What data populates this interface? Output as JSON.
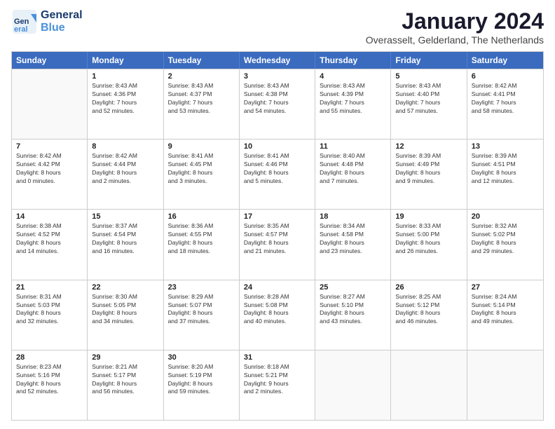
{
  "logo": {
    "general": "General",
    "blue": "Blue"
  },
  "header": {
    "title": "January 2024",
    "subtitle": "Overasselt, Gelderland, The Netherlands"
  },
  "weekdays": [
    "Sunday",
    "Monday",
    "Tuesday",
    "Wednesday",
    "Thursday",
    "Friday",
    "Saturday"
  ],
  "weeks": [
    [
      {
        "day": "",
        "empty": true
      },
      {
        "day": "1",
        "sunrise": "8:43 AM",
        "sunset": "4:36 PM",
        "daylight": "7 hours and 52 minutes."
      },
      {
        "day": "2",
        "sunrise": "8:43 AM",
        "sunset": "4:37 PM",
        "daylight": "7 hours and 53 minutes."
      },
      {
        "day": "3",
        "sunrise": "8:43 AM",
        "sunset": "4:38 PM",
        "daylight": "7 hours and 54 minutes."
      },
      {
        "day": "4",
        "sunrise": "8:43 AM",
        "sunset": "4:39 PM",
        "daylight": "7 hours and 55 minutes."
      },
      {
        "day": "5",
        "sunrise": "8:43 AM",
        "sunset": "4:40 PM",
        "daylight": "7 hours and 57 minutes."
      },
      {
        "day": "6",
        "sunrise": "8:42 AM",
        "sunset": "4:41 PM",
        "daylight": "7 hours and 58 minutes."
      }
    ],
    [
      {
        "day": "7",
        "sunrise": "8:42 AM",
        "sunset": "4:42 PM",
        "daylight": "8 hours and 0 minutes."
      },
      {
        "day": "8",
        "sunrise": "8:42 AM",
        "sunset": "4:44 PM",
        "daylight": "8 hours and 2 minutes."
      },
      {
        "day": "9",
        "sunrise": "8:41 AM",
        "sunset": "4:45 PM",
        "daylight": "8 hours and 3 minutes."
      },
      {
        "day": "10",
        "sunrise": "8:41 AM",
        "sunset": "4:46 PM",
        "daylight": "8 hours and 5 minutes."
      },
      {
        "day": "11",
        "sunrise": "8:40 AM",
        "sunset": "4:48 PM",
        "daylight": "8 hours and 7 minutes."
      },
      {
        "day": "12",
        "sunrise": "8:39 AM",
        "sunset": "4:49 PM",
        "daylight": "8 hours and 9 minutes."
      },
      {
        "day": "13",
        "sunrise": "8:39 AM",
        "sunset": "4:51 PM",
        "daylight": "8 hours and 12 minutes."
      }
    ],
    [
      {
        "day": "14",
        "sunrise": "8:38 AM",
        "sunset": "4:52 PM",
        "daylight": "8 hours and 14 minutes."
      },
      {
        "day": "15",
        "sunrise": "8:37 AM",
        "sunset": "4:54 PM",
        "daylight": "8 hours and 16 minutes."
      },
      {
        "day": "16",
        "sunrise": "8:36 AM",
        "sunset": "4:55 PM",
        "daylight": "8 hours and 18 minutes."
      },
      {
        "day": "17",
        "sunrise": "8:35 AM",
        "sunset": "4:57 PM",
        "daylight": "8 hours and 21 minutes."
      },
      {
        "day": "18",
        "sunrise": "8:34 AM",
        "sunset": "4:58 PM",
        "daylight": "8 hours and 23 minutes."
      },
      {
        "day": "19",
        "sunrise": "8:33 AM",
        "sunset": "5:00 PM",
        "daylight": "8 hours and 26 minutes."
      },
      {
        "day": "20",
        "sunrise": "8:32 AM",
        "sunset": "5:02 PM",
        "daylight": "8 hours and 29 minutes."
      }
    ],
    [
      {
        "day": "21",
        "sunrise": "8:31 AM",
        "sunset": "5:03 PM",
        "daylight": "8 hours and 32 minutes."
      },
      {
        "day": "22",
        "sunrise": "8:30 AM",
        "sunset": "5:05 PM",
        "daylight": "8 hours and 34 minutes."
      },
      {
        "day": "23",
        "sunrise": "8:29 AM",
        "sunset": "5:07 PM",
        "daylight": "8 hours and 37 minutes."
      },
      {
        "day": "24",
        "sunrise": "8:28 AM",
        "sunset": "5:08 PM",
        "daylight": "8 hours and 40 minutes."
      },
      {
        "day": "25",
        "sunrise": "8:27 AM",
        "sunset": "5:10 PM",
        "daylight": "8 hours and 43 minutes."
      },
      {
        "day": "26",
        "sunrise": "8:25 AM",
        "sunset": "5:12 PM",
        "daylight": "8 hours and 46 minutes."
      },
      {
        "day": "27",
        "sunrise": "8:24 AM",
        "sunset": "5:14 PM",
        "daylight": "8 hours and 49 minutes."
      }
    ],
    [
      {
        "day": "28",
        "sunrise": "8:23 AM",
        "sunset": "5:16 PM",
        "daylight": "8 hours and 52 minutes."
      },
      {
        "day": "29",
        "sunrise": "8:21 AM",
        "sunset": "5:17 PM",
        "daylight": "8 hours and 56 minutes."
      },
      {
        "day": "30",
        "sunrise": "8:20 AM",
        "sunset": "5:19 PM",
        "daylight": "8 hours and 59 minutes."
      },
      {
        "day": "31",
        "sunrise": "8:18 AM",
        "sunset": "5:21 PM",
        "daylight": "9 hours and 2 minutes."
      },
      {
        "day": "",
        "empty": true
      },
      {
        "day": "",
        "empty": true
      },
      {
        "day": "",
        "empty": true
      }
    ]
  ]
}
